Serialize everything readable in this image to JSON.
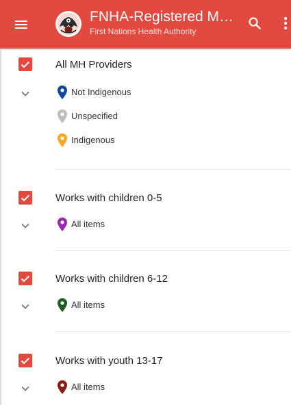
{
  "header": {
    "title": "FNHA-Registered MH …",
    "subtitle": "First Nations Health Authority",
    "background_color": "#e34a3f",
    "icons": {
      "menu": "menu-icon",
      "logo": "fnha-logo",
      "search": "search-icon",
      "more": "more-vert-icon"
    }
  },
  "layers": [
    {
      "title": "All MH Providers",
      "checked": true,
      "legend": [
        {
          "label": "Not Indigenous",
          "color": "#0d47a1"
        },
        {
          "label": "Unspecified",
          "color": "#bdbdbd"
        },
        {
          "label": "Indigenous",
          "color": "#f9a825"
        }
      ]
    },
    {
      "title": "Works with children 0-5",
      "checked": true,
      "legend": [
        {
          "label": "All items",
          "color": "#9c27b0"
        }
      ]
    },
    {
      "title": "Works with children 6-12",
      "checked": true,
      "legend": [
        {
          "label": "All items",
          "color": "#1b5e20"
        }
      ]
    },
    {
      "title": "Works with youth 13-17",
      "checked": true,
      "legend": [
        {
          "label": "All items",
          "color": "#8b1a10"
        }
      ]
    }
  ]
}
